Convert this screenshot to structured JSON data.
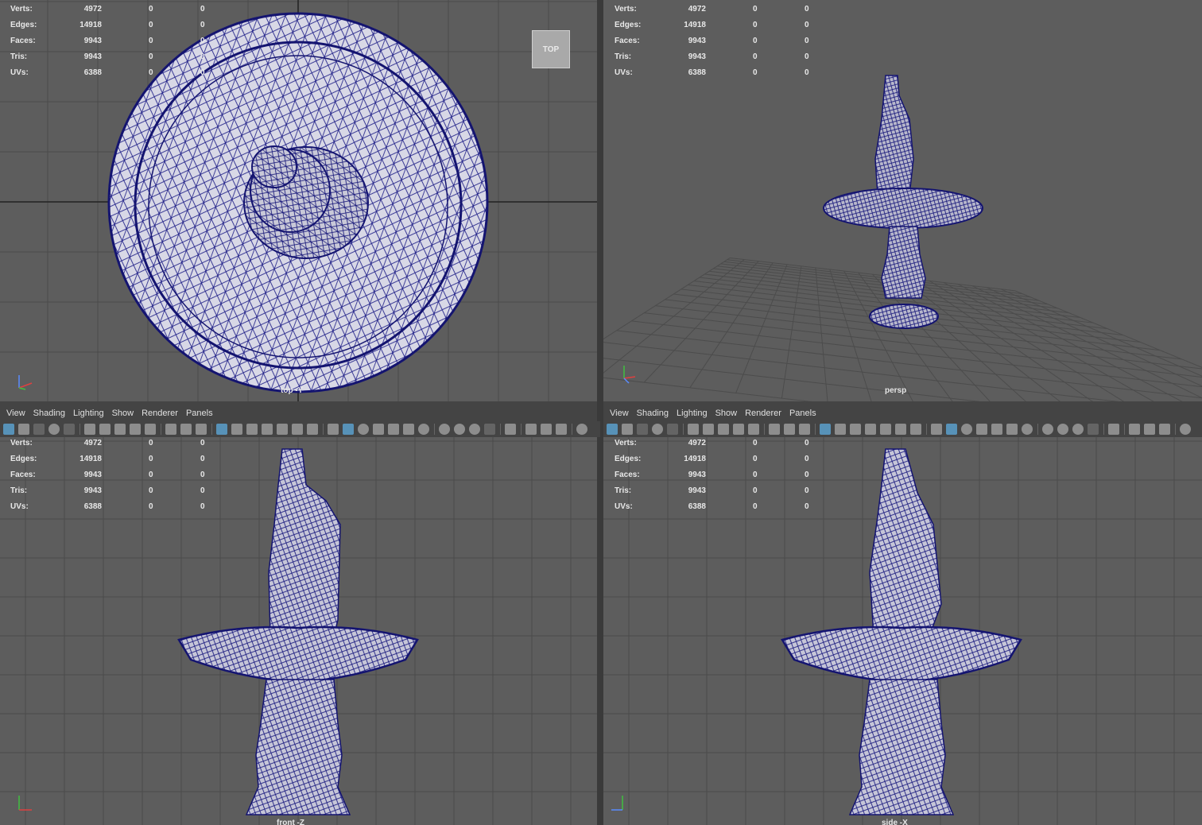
{
  "menu": {
    "items": [
      "View",
      "Shading",
      "Lighting",
      "Show",
      "Renderer",
      "Panels"
    ]
  },
  "hud": {
    "labels": [
      "Verts:",
      "Edges:",
      "Faces:",
      "Tris:",
      "UVs:"
    ],
    "rows": [
      {
        "label": "Verts:",
        "v1": "4972",
        "v2": "0",
        "v3": "0"
      },
      {
        "label": "Edges:",
        "v1": "14918",
        "v2": "0",
        "v3": "0"
      },
      {
        "label": "Faces:",
        "v1": "9943",
        "v2": "0",
        "v3": "0"
      },
      {
        "label": "Tris:",
        "v1": "9943",
        "v2": "0",
        "v3": "0"
      },
      {
        "label": "UVs:",
        "v1": "6388",
        "v2": "0",
        "v3": "0"
      }
    ]
  },
  "viewports": {
    "top": {
      "camera": "top -Y",
      "viewcube": "TOP"
    },
    "persp": {
      "camera": "persp"
    },
    "front": {
      "camera": "front -Z"
    },
    "side": {
      "camera": "side -X"
    }
  },
  "axes": {
    "x": "x",
    "y": "y",
    "z": "z"
  },
  "colors": {
    "viewport_bg": "#5d5d5d",
    "grid": "#4a4a4a",
    "wire": "#1a1a80",
    "mesh_fill": "#d6d6e6",
    "ui_bg": "#444444",
    "selected_icon": "#5aa0cc"
  },
  "icons": [
    "select-all-icon",
    "camera-icon",
    "bookmark-icon",
    "grid-icon",
    "film-gate-icon",
    "wireframe-icon",
    "smooth-shade-icon",
    "xray-icon",
    "light-icon",
    "isolate-icon",
    "viewport-2-icon"
  ]
}
